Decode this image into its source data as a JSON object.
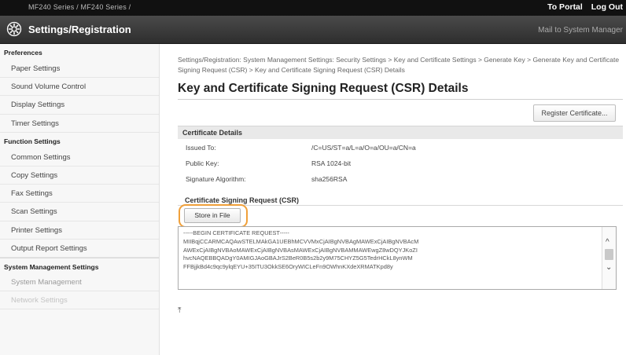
{
  "topbar": {
    "device": "MF240 Series / MF240 Series /",
    "portal_link": "To Portal",
    "logout_link": "Log Out"
  },
  "header": {
    "title": "Settings/Registration",
    "mail_link": "Mail to System Manager"
  },
  "sidebar": {
    "preferences_heading": "Preferences",
    "preferences_items": [
      "Paper Settings",
      "Sound Volume Control",
      "Display Settings",
      "Timer Settings"
    ],
    "function_heading": "Function Settings",
    "function_items": [
      "Common Settings",
      "Copy Settings",
      "Fax Settings",
      "Scan Settings",
      "Printer Settings",
      "Output Report Settings"
    ],
    "system_heading": "System Management Settings",
    "system_items": [
      "System Management",
      "Network Settings"
    ]
  },
  "main": {
    "breadcrumb": "Settings/Registration: System Management Settings: Security Settings > Key and Certificate Settings > Generate Key > Generate Key and Certificate Signing Request (CSR) > Key and Certificate Signing Request (CSR) Details",
    "title": "Key and Certificate Signing Request (CSR) Details",
    "register_button": "Register Certificate...",
    "certificate_section": "Certificate Details",
    "details": [
      {
        "label": "Issued To:",
        "value": "/C=US/ST=a/L=a/O=a/OU=a/CN=a"
      },
      {
        "label": "Public Key:",
        "value": "RSA 1024-bit"
      },
      {
        "label": "Signature Algorithm:",
        "value": "sha256RSA"
      }
    ],
    "csr_heading": "Certificate Signing Request (CSR)",
    "store_button": "Store in File",
    "csr_lines": [
      "-----BEGIN CERTIFICATE REQUEST-----",
      "MIIBqjCCARMCAQAwSTELMAkGA1UEBhMCVVMxCjAIBgNVBAgMAWExCjAIBgNVBAcM",
      "AWExCjAIBgNVBAoMAWExCjAIBgNVBAsMAWExCjAIBgNVBAMMAWEwgZ8wDQYJKoZI",
      "hvcNAQEBBQADgY0AMIGJAoGBAJrS2BeR0B5s2b2y9M75CHYZ5G5TedrHCkL8ynWM",
      "FFBjjkBd4c9qc9ylqEYU+35ITU3OkkSE6OryWICLeFn9OWhnKXdeXRMATKpd8y"
    ]
  }
}
